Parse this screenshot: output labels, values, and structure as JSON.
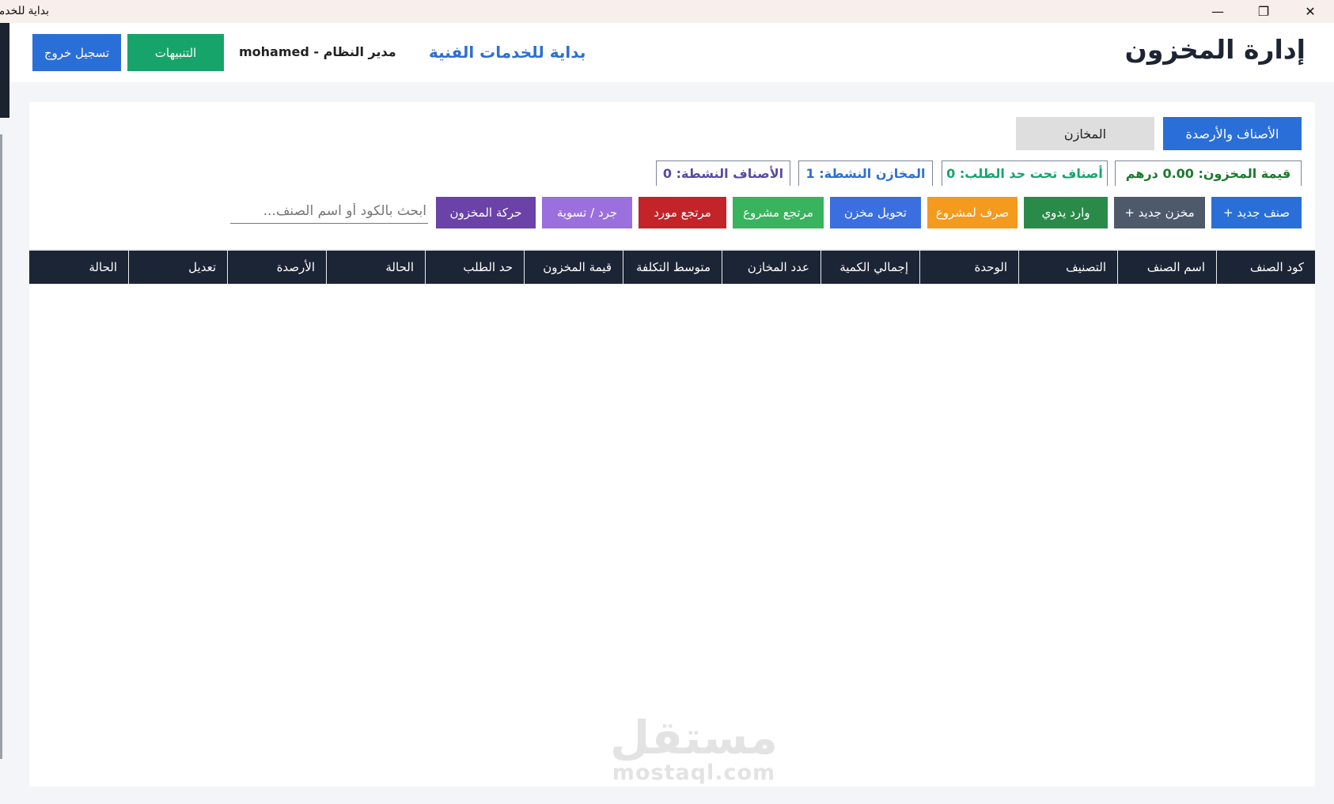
{
  "window": {
    "title": "بداية للخدمات الفنية",
    "minimize": "—",
    "maximize": "❐",
    "close": "✕"
  },
  "header": {
    "app_title": "إدارة المخزون",
    "company": "بداية للخدمات الفنية",
    "user_info": "مدير النظام - mohamed",
    "alerts_label": "التنبيهات",
    "logout_label": "تسجيل خروج"
  },
  "tabs": {
    "items_balances": "الأصناف والأرصدة",
    "stores": "المخازن"
  },
  "stats": {
    "inventory_value": "قيمة المخزون: 0.00 درهم",
    "below_reorder": "أصناف تحت حد الطلب: 0",
    "active_stores": "المخازن النشطة: 1",
    "active_items": "الأصناف النشطة: 0"
  },
  "actions": {
    "new_item": "صنف جديد +",
    "new_store": "مخزن جديد +",
    "manual_receipt": "وارد يدوي",
    "issue_to_project": "صرف لمشروع",
    "store_transfer": "تحويل مخزن",
    "project_return": "مرتجع مشروع",
    "supplier_return": "مرتجع مورد",
    "stocktake": "جرد / تسوية",
    "stock_movement": "حركة المخزون"
  },
  "search": {
    "placeholder": "ابحث بالكود أو اسم الصنف..."
  },
  "table": {
    "columns": [
      "كود الصنف",
      "اسم الصنف",
      "التصنيف",
      "الوحدة",
      "إجمالي الكمية",
      "عدد المخازن",
      "متوسط التكلفة",
      "قيمة المخزون",
      "حد الطلب",
      "الحالة",
      "الأرصدة",
      "تعديل",
      "الحالة"
    ],
    "rows": []
  },
  "watermark": {
    "arabic": "مستقل",
    "latin": "mostaql.com"
  }
}
